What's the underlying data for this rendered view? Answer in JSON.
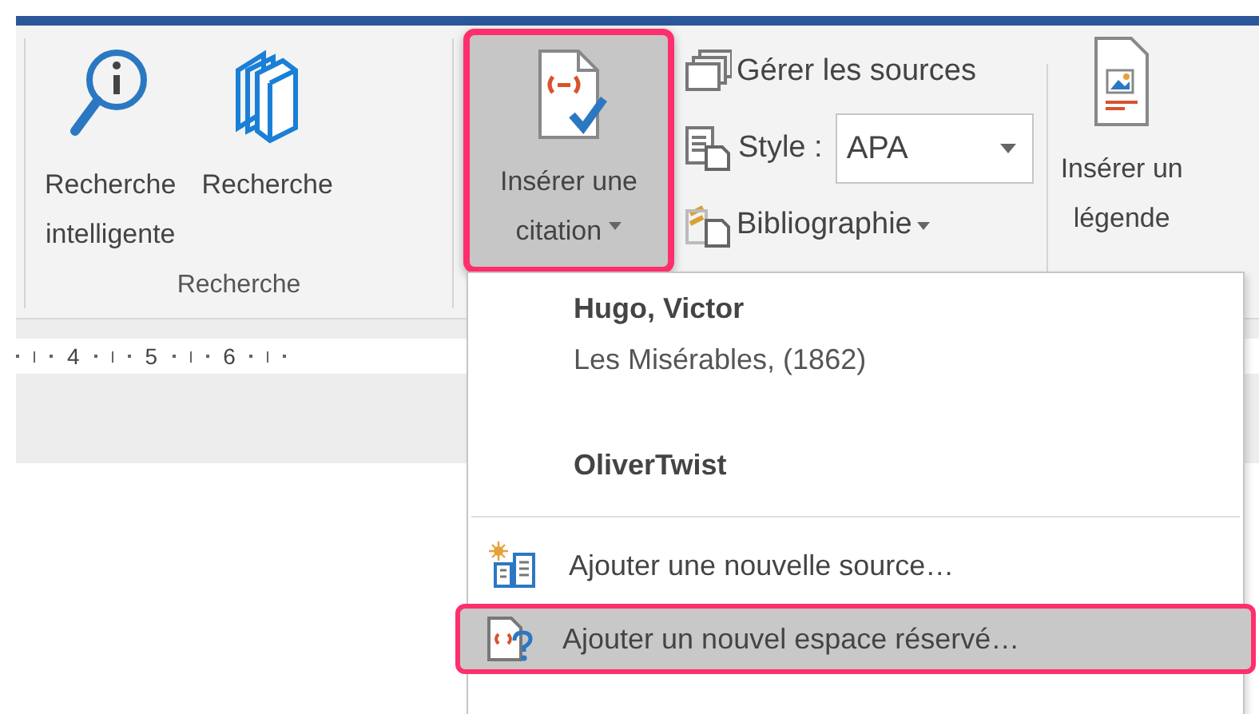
{
  "ribbon": {
    "research_group": {
      "label": "Recherche",
      "buttons": [
        {
          "kind": "smart-lookup",
          "lines": [
            "Recherche",
            "intelligente"
          ]
        },
        {
          "kind": "researcher",
          "lines": [
            "Recherche"
          ]
        }
      ]
    },
    "insert_citation": {
      "lines": [
        "Insérer une",
        "citation"
      ],
      "selected": true
    },
    "manage_sources": "Gérer les sources",
    "style": {
      "label": "Style :",
      "value": "APA"
    },
    "bibliography": "Bibliographie",
    "insert_caption": {
      "lines": [
        "Insérer un",
        "légende"
      ]
    }
  },
  "ruler": {
    "labels": [
      "4",
      "5",
      "6"
    ]
  },
  "menu": {
    "sources": [
      {
        "author": "Hugo, Victor",
        "title": "Les Misérables, (1862)"
      },
      {
        "author": "OliverTwist"
      }
    ],
    "commands": [
      {
        "kind": "new-source",
        "label": "Ajouter une nouvelle source…",
        "selected": false
      },
      {
        "kind": "placeholder",
        "label": "Ajouter un nouvel espace réservé…",
        "selected": true
      }
    ]
  }
}
